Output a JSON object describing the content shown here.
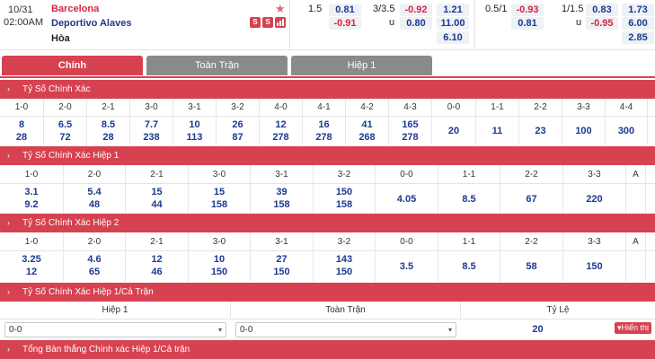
{
  "match": {
    "date": "10/31",
    "time": "02:00AM",
    "home": "Barcelona",
    "away": "Deportivo Alaves",
    "draw": "Hòa",
    "icons": [
      "S",
      "S",
      "chart-icon"
    ]
  },
  "odds": {
    "handicap_line": "1.5",
    "handicap_home": "0.81",
    "handicap_away": "-0.91",
    "ou_line": "3/3.5",
    "ou_over": "-0.92",
    "ou_under_label": "u",
    "ou_under": "0.80",
    "x12_home": "1.21",
    "x12_away": "11.00",
    "x12_draw": "6.10",
    "ht_handicap_line": "0.5/1",
    "ht_handicap_home": "-0.93",
    "ht_handicap_away": "0.81",
    "ht_ou_line": "1/1.5",
    "ht_ou_over": "0.83",
    "ht_ou_under_label": "u",
    "ht_ou_under": "-0.95",
    "ht_x12_home": "1.73",
    "ht_x12_away": "6.00",
    "ht_x12_draw": "2.85"
  },
  "tabs": [
    {
      "label": "Chính"
    },
    {
      "label": "Toàn Trận"
    },
    {
      "label": "Hiệp 1"
    }
  ],
  "sections": {
    "exact": "Tỷ Số Chính Xác",
    "exact_h1": "Tỷ Số Chính Xác Hiệp 1",
    "exact_h2": "Tỷ Số Chính Xác Hiệp 2",
    "htft": "Tỷ Số Chính Xác Hiệp 1/Cả Trận",
    "total": "Tổng Bàn thắng Chính xác Hiệp 1/Cả trận"
  },
  "exact": {
    "headers": [
      "1-0",
      "2-0",
      "2-1",
      "3-0",
      "3-1",
      "3-2",
      "4-0",
      "4-1",
      "4-2",
      "4-3",
      "0-0",
      "1-1",
      "2-2",
      "3-3",
      "4-4"
    ],
    "top": [
      "8",
      "6.5",
      "8.5",
      "7.7",
      "10",
      "26",
      "12",
      "16",
      "41",
      "165",
      "20",
      "11",
      "23",
      "100",
      "300"
    ],
    "bottom": [
      "28",
      "72",
      "28",
      "238",
      "113",
      "87",
      "278",
      "278",
      "268",
      "278",
      "",
      "",
      "",
      "",
      ""
    ]
  },
  "exact_h1": {
    "headers": [
      "1-0",
      "2-0",
      "2-1",
      "3-0",
      "3-1",
      "3-2",
      "0-0",
      "1-1",
      "2-2",
      "3-3",
      "A"
    ],
    "top": [
      "3.1",
      "5.4",
      "15",
      "15",
      "39",
      "150",
      "4.05",
      "8.5",
      "67",
      "220",
      ""
    ],
    "bottom": [
      "9.2",
      "48",
      "44",
      "158",
      "158",
      "158",
      "",
      "",
      "",
      "",
      ""
    ]
  },
  "exact_h2": {
    "headers": [
      "1-0",
      "2-0",
      "2-1",
      "3-0",
      "3-1",
      "3-2",
      "0-0",
      "1-1",
      "2-2",
      "3-3",
      "A"
    ],
    "top": [
      "3.25",
      "4.6",
      "12",
      "10",
      "27",
      "143",
      "3.5",
      "8.5",
      "58",
      "150",
      ""
    ],
    "bottom": [
      "12",
      "65",
      "46",
      "150",
      "150",
      "150",
      "",
      "",
      "",
      "",
      ""
    ]
  },
  "htft": {
    "col_h1": "Hiệp 1",
    "col_ft": "Toàn Trận",
    "col_ratio": "Tỷ Lệ",
    "h1_value": "0-0",
    "ft_value": "0-0",
    "ratio": "20",
    "show_button": "▾Hiển thị"
  },
  "colors": {
    "accent": "#d64250",
    "blue": "#1a3a8f",
    "red": "#d4273f"
  }
}
